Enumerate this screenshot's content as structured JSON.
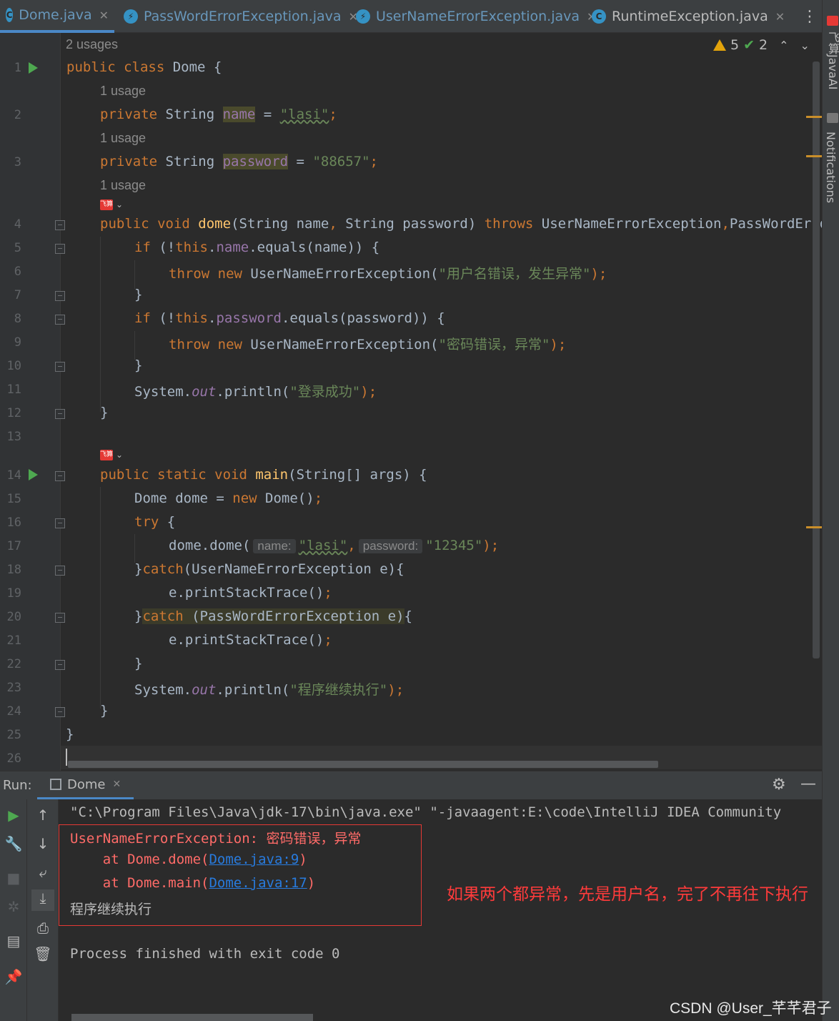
{
  "tabs": [
    {
      "label": "Dome.java",
      "icon": "class-icon",
      "active": true
    },
    {
      "label": "PassWordErrorException.java",
      "icon": "exception-icon",
      "active": false
    },
    {
      "label": "UserNameErrorException.java",
      "icon": "exception-icon",
      "active": false
    },
    {
      "label": "RuntimeException.java",
      "icon": "class-icon",
      "active": false
    }
  ],
  "inspections": {
    "warnings": "5",
    "weak_warnings": "2"
  },
  "side_labels": {
    "plugin": "飞算JavaAI",
    "notifications": "Notifications"
  },
  "usages": {
    "class": "2 usages",
    "name": "1 usage",
    "password": "1 usage",
    "dome": "1 usage"
  },
  "badge_text": "飞算",
  "line_numbers": [
    "1",
    "2",
    "3",
    "4",
    "5",
    "6",
    "7",
    "8",
    "9",
    "10",
    "11",
    "12",
    "13",
    "14",
    "15",
    "16",
    "17",
    "18",
    "19",
    "20",
    "21",
    "22",
    "23",
    "24",
    "25",
    "26"
  ],
  "code": {
    "l1": {
      "kw": "public class",
      "name": " Dome {"
    },
    "l2": {
      "kw": "private",
      "type": " String ",
      "field": "name",
      "eq": " = ",
      "str": "\"lasi\"",
      "end": ";"
    },
    "l3": {
      "kw": "private",
      "type": " String ",
      "field": "password",
      "eq": " = ",
      "str": "\"88657\"",
      "end": ";"
    },
    "l4": {
      "kw": "public void",
      "fn": "dome",
      "params": "(String name",
      "c1": ",",
      "params2": " String password) ",
      "kw2": "throws",
      "rest": " UserNameErrorException",
      "c2": ",",
      "rest2": "PassWordErrorException {"
    },
    "l5": {
      "kw": "if",
      "a": " (!",
      "kw2": "this",
      "dot": ".",
      "field": "name",
      "rest": ".equals(name)) {"
    },
    "l6": {
      "kw": "throw new",
      "rest": " UserNameErrorException(",
      "str": "\"用户名错误，发生异常\"",
      "end": ");"
    },
    "l7": "}",
    "l8": {
      "kw": "if",
      "a": " (!",
      "kw2": "this",
      "dot": ".",
      "field": "password",
      "rest": ".equals(password)) {"
    },
    "l9": {
      "kw": "throw new",
      "rest": " UserNameErrorException(",
      "str": "\"密码错误，异常\"",
      "end": ");"
    },
    "l10": "}",
    "l11": {
      "a": "System.",
      "stat": "out",
      "b": ".println(",
      "str": "\"登录成功\"",
      "end": ");"
    },
    "l12": "}",
    "l14": {
      "kw": "public static void",
      "fn": "main",
      "rest": "(String[] args) {"
    },
    "l15": {
      "a": "Dome dome = ",
      "kw": "new",
      "b": " Dome()",
      "end": ";"
    },
    "l16": {
      "kw": "try",
      "rest": " {"
    },
    "l17": {
      "a": "dome.dome(",
      "hint1": "name:",
      "str1": "\"lasi\"",
      "c": ",",
      "hint2": "password:",
      "str2": "\"12345\"",
      "end": ");"
    },
    "l18": {
      "a": "}",
      "kw": "catch",
      "rest": "(UserNameErrorException e){"
    },
    "l19": {
      "a": "e.printStackTrace()",
      "end": ";"
    },
    "l20": {
      "a": "}",
      "kw": "catch",
      "rest": " (PassWordErrorException e)",
      "b": "{"
    },
    "l21": {
      "a": "e.printStackTrace()",
      "end": ";"
    },
    "l22": "}",
    "l23": {
      "a": "System.",
      "stat": "out",
      "b": ".println(",
      "str": "\"程序继续执行\"",
      "end": ");"
    },
    "l24": "}",
    "l25": "}"
  },
  "run": {
    "label": "Run:",
    "tab": "Dome",
    "cmd": "\"C:\\Program Files\\Java\\jdk-17\\bin\\java.exe\" \"-javaagent:E:\\code\\IntelliJ IDEA Community",
    "exception": "UserNameErrorException: 密码错误，异常",
    "at1_pre": "    at Dome.dome(",
    "at1_link": "Dome.java:9",
    "at1_post": ")",
    "at2_pre": "    at Dome.main(",
    "at2_link": "Dome.java:17",
    "at2_post": ")",
    "continue": "程序继续执行",
    "finished": "Process finished with exit code 0"
  },
  "annotation": "如果两个都异常，先是用户名，完了不再往下执行",
  "watermark": "CSDN @User_芊芊君子"
}
